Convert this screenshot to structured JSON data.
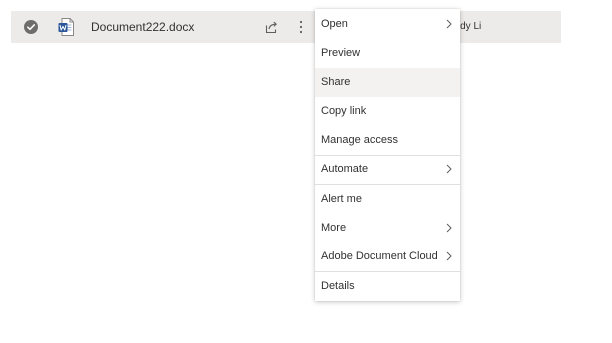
{
  "file_row": {
    "file_name": "Document222.docx",
    "modified_by": "endy Li",
    "file_type_icon": "word-doc-icon"
  },
  "context_menu": {
    "items": [
      {
        "label": "Open",
        "has_submenu": true
      },
      {
        "label": "Preview",
        "has_submenu": false
      },
      {
        "label": "Share",
        "has_submenu": false,
        "highlighted": true
      },
      {
        "label": "Copy link",
        "has_submenu": false
      },
      {
        "label": "Manage access",
        "has_submenu": false
      },
      {
        "label": "Automate",
        "has_submenu": true
      },
      {
        "label": "Alert me",
        "has_submenu": false
      },
      {
        "label": "More",
        "has_submenu": true
      },
      {
        "label": "Adobe Document Cloud",
        "has_submenu": true
      },
      {
        "label": "Details",
        "has_submenu": false
      }
    ]
  },
  "colors": {
    "row_selected_bg": "#edebe9",
    "menu_hover_bg": "#f3f2f1",
    "word_blue": "#2b579a",
    "text": "#323130"
  }
}
